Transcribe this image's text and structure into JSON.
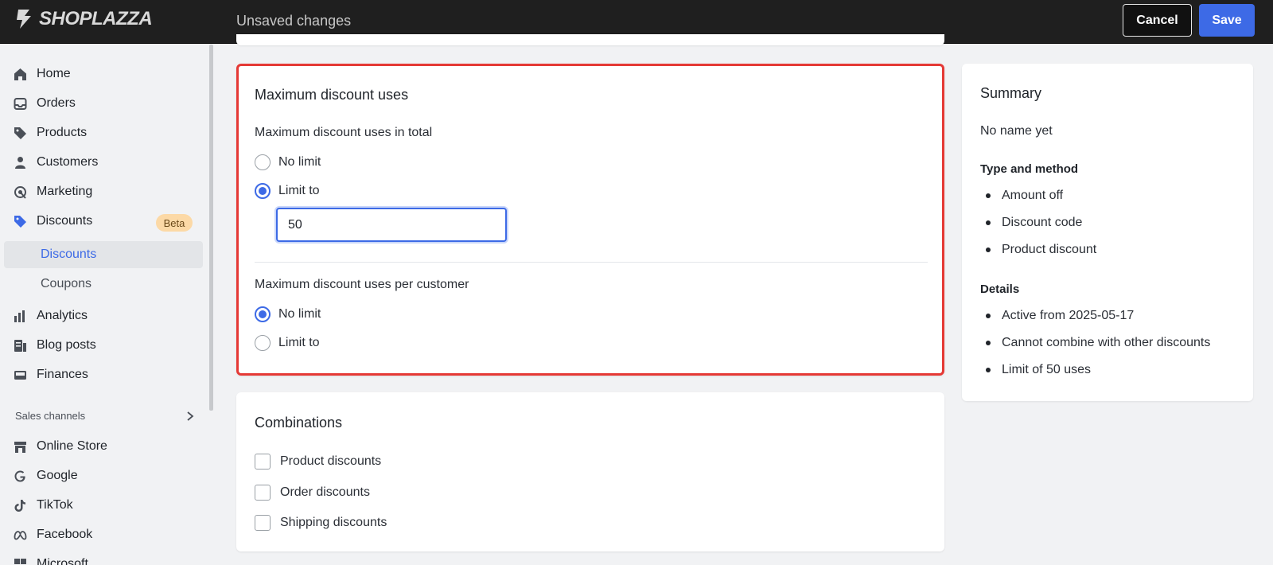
{
  "topbar": {
    "logo_text": "SHOPLAZZA",
    "status": "Unsaved changes",
    "cancel_label": "Cancel",
    "save_label": "Save"
  },
  "sidebar": {
    "items": [
      {
        "label": "Home",
        "icon": "home-icon"
      },
      {
        "label": "Orders",
        "icon": "inbox-icon"
      },
      {
        "label": "Products",
        "icon": "tag-icon"
      },
      {
        "label": "Customers",
        "icon": "person-icon"
      },
      {
        "label": "Marketing",
        "icon": "target-icon"
      },
      {
        "label": "Discounts",
        "icon": "discount-tag-icon",
        "badge": "Beta"
      },
      {
        "label": "Analytics",
        "icon": "bar-chart-icon"
      },
      {
        "label": "Blog posts",
        "icon": "document-icon"
      },
      {
        "label": "Finances",
        "icon": "wallet-icon"
      }
    ],
    "sub_items": [
      {
        "label": "Discounts",
        "active": true
      },
      {
        "label": "Coupons",
        "active": false
      }
    ],
    "sales_channels_label": "Sales channels",
    "channels": [
      {
        "label": "Online Store",
        "icon": "store-icon"
      },
      {
        "label": "Google",
        "icon": "google-icon"
      },
      {
        "label": "TikTok",
        "icon": "tiktok-icon"
      },
      {
        "label": "Facebook",
        "icon": "meta-icon"
      },
      {
        "label": "Microsoft",
        "icon": "microsoft-icon"
      }
    ]
  },
  "max_uses": {
    "title": "Maximum discount uses",
    "total_label": "Maximum discount uses in total",
    "total_options": [
      {
        "label": "No limit",
        "selected": false
      },
      {
        "label": "Limit to",
        "selected": true
      }
    ],
    "total_value": "50",
    "per_customer_label": "Maximum discount uses per customer",
    "per_customer_options": [
      {
        "label": "No limit",
        "selected": true
      },
      {
        "label": "Limit to",
        "selected": false
      }
    ]
  },
  "combinations": {
    "title": "Combinations",
    "options": [
      {
        "label": "Product discounts",
        "checked": false
      },
      {
        "label": "Order discounts",
        "checked": false
      },
      {
        "label": "Shipping discounts",
        "checked": false
      }
    ]
  },
  "summary": {
    "title": "Summary",
    "name": "No name yet",
    "type_heading": "Type and method",
    "type_items": [
      "Amount off",
      "Discount code",
      "Product discount"
    ],
    "details_heading": "Details",
    "details_items": [
      "Active from 2025-05-17",
      "Cannot combine with other discounts",
      "Limit of 50 uses"
    ]
  },
  "colors": {
    "accent": "#3d6ae6",
    "highlight_border": "#e53935",
    "topbar": "#1f1f1f",
    "beta_badge": "#fcd9a6"
  }
}
